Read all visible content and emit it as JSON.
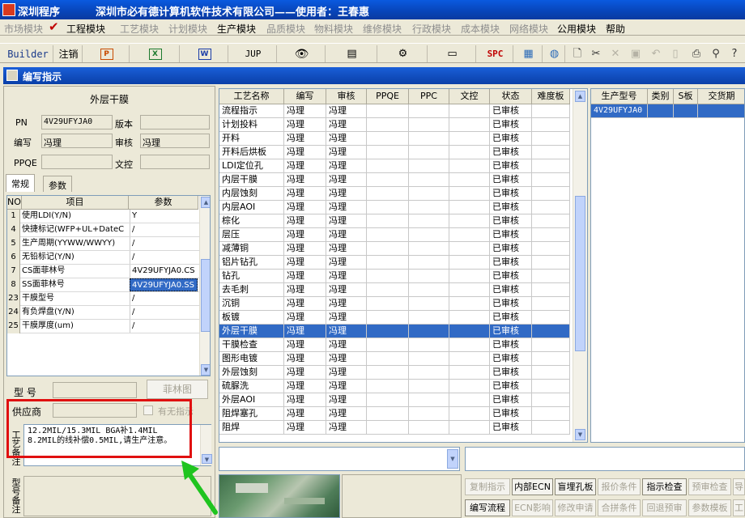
{
  "window": {
    "title_left": "深圳程序",
    "title_main": "深圳市必有德计算机软件技术有限公司——使用者：王春惠"
  },
  "menu": [
    {
      "label": "市场模块",
      "active": false
    },
    {
      "label": "工程模块",
      "active": true
    },
    {
      "label": "工艺模块",
      "active": false
    },
    {
      "label": "计划模块",
      "active": false
    },
    {
      "label": "生产模块",
      "active": true
    },
    {
      "label": "品质模块",
      "active": false
    },
    {
      "label": "物料模块",
      "active": false
    },
    {
      "label": "维修模块",
      "active": false
    },
    {
      "label": "行政模块",
      "active": false
    },
    {
      "label": "成本模块",
      "active": false
    },
    {
      "label": "网络模块",
      "active": false
    },
    {
      "label": "公用模块",
      "active": true
    },
    {
      "label": "帮助",
      "active": true
    }
  ],
  "toolbar": {
    "builder": "Builder",
    "logout": "注销",
    "jup": "JUP",
    "spc": "SPC"
  },
  "subwindow": {
    "title": "编写指示"
  },
  "left": {
    "header": "外层干膜",
    "pn_label": "PN",
    "pn_value": "4V29UFYJA0",
    "version_label": "版本",
    "version_value": "",
    "writer_label": "编写",
    "writer_value": "冯理",
    "reviewer_label": "审核",
    "reviewer_value": "冯理",
    "ppqe_label": "PPQE",
    "ppqe_value": "",
    "wenkong_label": "文控",
    "wenkong_value": "",
    "tabs": [
      "常规",
      "参数"
    ],
    "grid_headers": [
      "NO",
      "项目",
      "参数"
    ],
    "params": [
      {
        "no": "1",
        "item": "使用LDI(Y/N)",
        "value": "Y"
      },
      {
        "no": "4",
        "item": "快捷标记(WFP+UL+DateC",
        "value": "/"
      },
      {
        "no": "5",
        "item": "生产周期(YYWW/WWYY)",
        "value": "/"
      },
      {
        "no": "6",
        "item": "无铅标记(Y/N)",
        "value": "/"
      },
      {
        "no": "7",
        "item": "CS面菲林号",
        "value": "4V29UFYJA0.CS"
      },
      {
        "no": "8",
        "item": "SS面菲林号",
        "value": "4V29UFYJA0.SS"
      },
      {
        "no": "23",
        "item": "干膜型号",
        "value": "/"
      },
      {
        "no": "24",
        "item": "有负焊盘(Y/N)",
        "value": "/"
      },
      {
        "no": "25",
        "item": "干膜厚度(um)",
        "value": "/"
      }
    ],
    "model_label": "型  号",
    "film_button": "菲林图",
    "supplier_label": "供应商",
    "no_instruction_label": "有无指示",
    "process_note_label": "工艺备注",
    "process_note_lines": [
      "12.2MIL/15.3MIL BGA补1.4MIL",
      "8.2MIL的线补偿0.5MIL,请生产注意。"
    ],
    "model_note_label": "型号备注"
  },
  "process_grid": {
    "headers": [
      "工艺名称",
      "编写",
      "审核",
      "PPQE",
      "PPC",
      "文控",
      "状态",
      "难度板"
    ],
    "rows": [
      {
        "name": "流程指示",
        "writer": "冯理",
        "reviewer": "冯理",
        "status": "已审核"
      },
      {
        "name": "计划投料",
        "writer": "冯理",
        "reviewer": "冯理",
        "status": "已审核"
      },
      {
        "name": "开料",
        "writer": "冯理",
        "reviewer": "冯理",
        "status": "已审核"
      },
      {
        "name": "开料后烘板",
        "writer": "冯理",
        "reviewer": "冯理",
        "status": "已审核"
      },
      {
        "name": "LDI定位孔",
        "writer": "冯理",
        "reviewer": "冯理",
        "status": "已审核"
      },
      {
        "name": "内层干膜",
        "writer": "冯理",
        "reviewer": "冯理",
        "status": "已审核"
      },
      {
        "name": "内层蚀刻",
        "writer": "冯理",
        "reviewer": "冯理",
        "status": "已审核"
      },
      {
        "name": "内层AOI",
        "writer": "冯理",
        "reviewer": "冯理",
        "status": "已审核"
      },
      {
        "name": "棕化",
        "writer": "冯理",
        "reviewer": "冯理",
        "status": "已审核"
      },
      {
        "name": "层压",
        "writer": "冯理",
        "reviewer": "冯理",
        "status": "已审核"
      },
      {
        "name": "减薄铜",
        "writer": "冯理",
        "reviewer": "冯理",
        "status": "已审核"
      },
      {
        "name": "铝片钻孔",
        "writer": "冯理",
        "reviewer": "冯理",
        "status": "已审核"
      },
      {
        "name": "钻孔",
        "writer": "冯理",
        "reviewer": "冯理",
        "status": "已审核"
      },
      {
        "name": "去毛刺",
        "writer": "冯理",
        "reviewer": "冯理",
        "status": "已审核"
      },
      {
        "name": "沉铜",
        "writer": "冯理",
        "reviewer": "冯理",
        "status": "已审核"
      },
      {
        "name": "板镀",
        "writer": "冯理",
        "reviewer": "冯理",
        "status": "已审核"
      },
      {
        "name": "外层干膜",
        "writer": "冯理",
        "reviewer": "冯理",
        "status": "已审核",
        "selected": true
      },
      {
        "name": "干膜检查",
        "writer": "冯理",
        "reviewer": "冯理",
        "status": "已审核"
      },
      {
        "name": "图形电镀",
        "writer": "冯理",
        "reviewer": "冯理",
        "status": "已审核"
      },
      {
        "name": "外层蚀刻",
        "writer": "冯理",
        "reviewer": "冯理",
        "status": "已审核"
      },
      {
        "name": "硫脲洗",
        "writer": "冯理",
        "reviewer": "冯理",
        "status": "已审核"
      },
      {
        "name": "外层AOI",
        "writer": "冯理",
        "reviewer": "冯理",
        "status": "已审核"
      },
      {
        "name": "阻焊塞孔",
        "writer": "冯理",
        "reviewer": "冯理",
        "status": "已审核"
      },
      {
        "name": "阻焊",
        "writer": "冯理",
        "reviewer": "冯理",
        "status": "已审核"
      }
    ]
  },
  "right_grid": {
    "headers": [
      "生产型号",
      "类别",
      "S板",
      "交货期"
    ],
    "rows": [
      [
        "4V29UFYJA0",
        "",
        "",
        ""
      ]
    ]
  },
  "bottom_buttons_row1": [
    {
      "label": "复制指示",
      "enabled": false
    },
    {
      "label": "内部ECN",
      "enabled": true
    },
    {
      "label": "盲埋孔板",
      "enabled": true
    },
    {
      "label": "报价条件",
      "enabled": false
    },
    {
      "label": "指示检查",
      "enabled": true
    },
    {
      "label": "预审检查",
      "enabled": false
    },
    {
      "label": "导",
      "enabled": false
    }
  ],
  "bottom_buttons_row2": [
    {
      "label": "编写流程",
      "enabled": true
    },
    {
      "label": "ECN影响",
      "enabled": false
    },
    {
      "label": "修改申请",
      "enabled": false
    },
    {
      "label": "合拼条件",
      "enabled": false
    },
    {
      "label": "回退预审",
      "enabled": false
    },
    {
      "label": "参数模板",
      "enabled": false
    },
    {
      "label": "工",
      "enabled": false
    }
  ],
  "colors": {
    "selection": "#316ac5",
    "title_bar": "#0a5adf",
    "annotation_red": "#e01010",
    "arrow_green": "#1fc41f"
  }
}
